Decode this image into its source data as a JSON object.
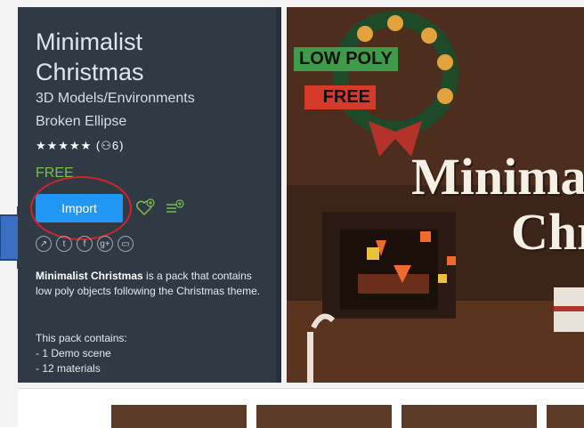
{
  "asset": {
    "title_line1": "Minimalist",
    "title_line2": "Christmas",
    "category": "3D Models/Environments",
    "publisher": "Broken Ellipse",
    "stars": "★★★★★",
    "rating_count": "(⚇6)",
    "price": "FREE",
    "import_label": "Import"
  },
  "social": [
    "↗",
    "t",
    "f",
    "g+",
    "▭"
  ],
  "description": {
    "name": "Minimalist Christmas",
    "text": " is a pack that contains low poly objects following the Christmas theme.",
    "contains_heading": "This pack contains:",
    "items": [
      "- 1 Demo scene",
      "- 12 materials"
    ]
  },
  "hero": {
    "badge_lowpoly": "LOW POLY",
    "badge_free": "FREE",
    "title_line1": "Minimalist",
    "title_line2": "Chri"
  },
  "colors": {
    "panel": "#2f3a45",
    "accent": "#2196f3",
    "price": "#7bc043"
  }
}
